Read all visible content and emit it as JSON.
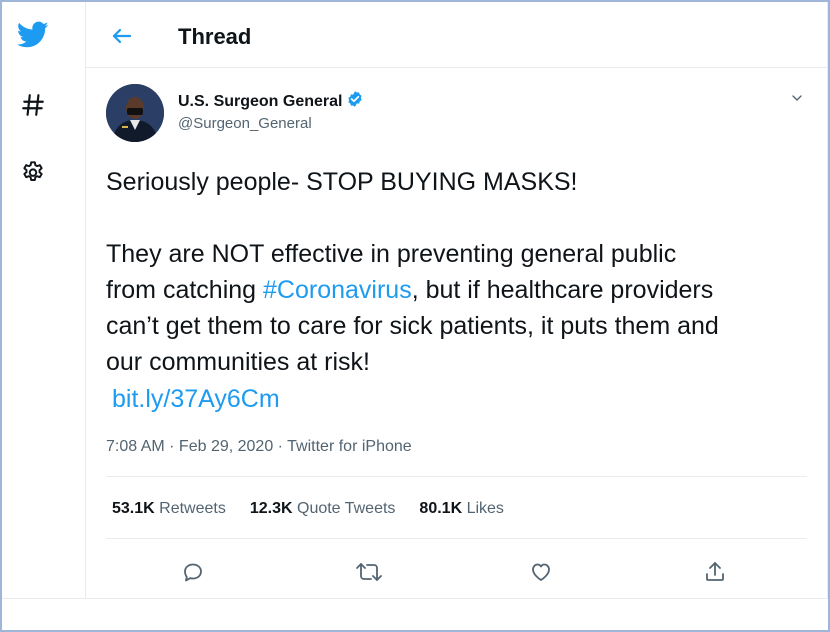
{
  "header": {
    "title": "Thread"
  },
  "sidebar": {
    "icons": [
      "twitter-bird-icon",
      "hashtag-icon",
      "gear-icon"
    ]
  },
  "tweet": {
    "author_name": "U.S. Surgeon General",
    "author_handle": "@Surgeon_General",
    "line1": "Seriously people- STOP BUYING MASKS!",
    "line2": "They are NOT effective in preventing general public",
    "line3_pre": "from catching ",
    "hashtag": "#Coronavirus",
    "line3_post": ", but if healthcare providers",
    "line4": "can’t get them to care for sick patients, it puts them and",
    "line5": "our communities at risk!",
    "link": "bit.ly/37Ay6Cm",
    "time": "7:08 AM",
    "date": "Feb 29, 2020",
    "source": "Twitter for iPhone",
    "sep": " · "
  },
  "stats": {
    "retweets_count": "53.1K",
    "retweets_label": " Retweets",
    "quotes_count": "12.3K",
    "quotes_label": " Quote Tweets",
    "likes_count": "80.1K",
    "likes_label": " Likes"
  },
  "colors": {
    "accent": "#1d9bf0",
    "border": "#9fb6d8",
    "text": "#0f1419",
    "muted": "#536471"
  }
}
